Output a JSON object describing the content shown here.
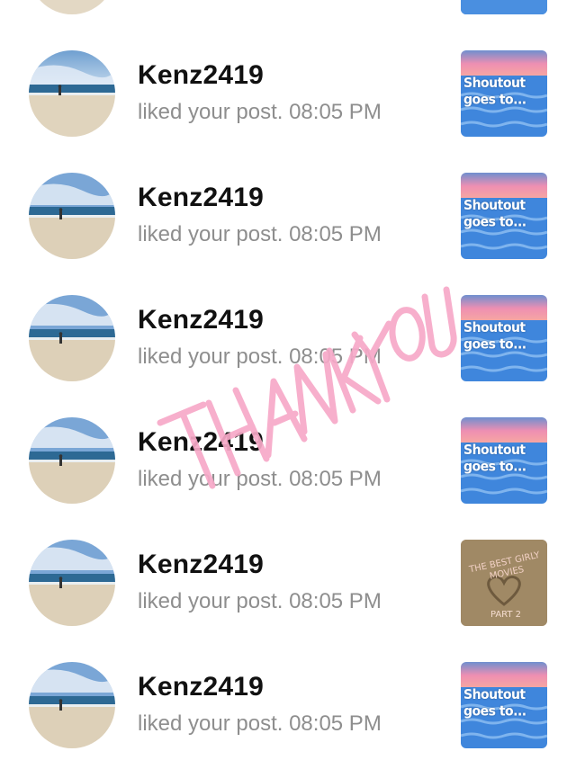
{
  "notifications": [
    {
      "username": "",
      "activity": "",
      "thumb": "shoutout",
      "thumb_text": ""
    },
    {
      "username": "Kenz2419",
      "activity": "liked your post. 08:05 PM",
      "thumb": "shoutout",
      "thumb_text": "Shoutout goes to..."
    },
    {
      "username": "Kenz2419",
      "activity": "liked your post. 08:05 PM",
      "thumb": "shoutout",
      "thumb_text": "Shoutout goes to..."
    },
    {
      "username": "Kenz2419",
      "activity": "liked your post. 08:05 PM",
      "thumb": "shoutout",
      "thumb_text": "Shoutout goes to..."
    },
    {
      "username": "Kenz2419",
      "activity": "liked your post. 08:05 PM",
      "thumb": "shoutout",
      "thumb_text": "Shoutout goes to..."
    },
    {
      "username": "Kenz2419",
      "activity": "liked your post. 08:05 PM",
      "thumb": "movies",
      "thumb_text": "THE BEST GIRLY MOVIES",
      "thumb_subtext": "PART 2"
    },
    {
      "username": "Kenz2419",
      "activity": "liked your post. 08:05 PM",
      "thumb": "shoutout",
      "thumb_text": "Shoutout goes to..."
    }
  ],
  "sticker": {
    "text": "THANK YOU",
    "color": "#f7a9c8"
  },
  "colors": {
    "username": "#111111",
    "activity": "#8e8e8e",
    "background": "#ffffff"
  }
}
